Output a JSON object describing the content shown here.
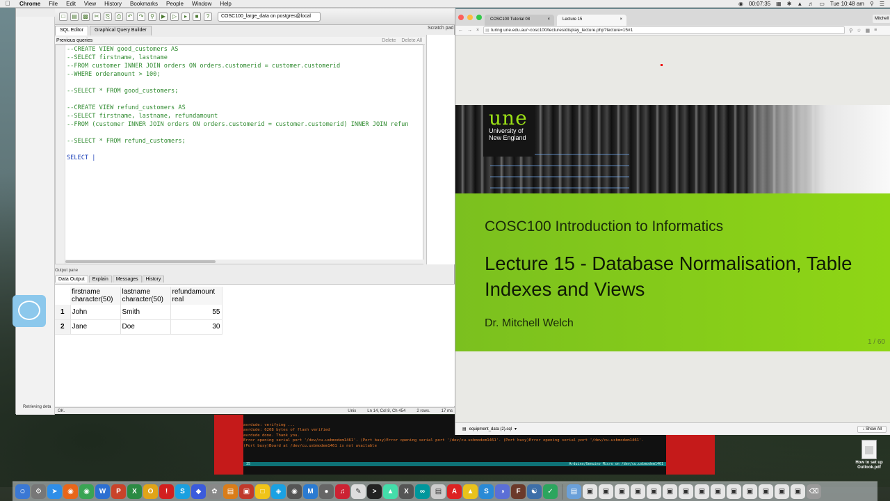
{
  "menubar": {
    "app_name": "Chrome",
    "items": [
      "File",
      "Edit",
      "View",
      "History",
      "Bookmarks",
      "People",
      "Window",
      "Help"
    ],
    "battery_time": "00:07:35",
    "clock": "Tue 10:48 am"
  },
  "pgadmin": {
    "connection": "COSC100_large_data on postgres@local",
    "tabs": [
      "SQL Editor",
      "Graphical Query Builder"
    ],
    "scratch_pad_label": "Scratch pad",
    "previous_queries_label": "Previous queries",
    "delete_label": "Delete",
    "delete_all_label": "Delete All",
    "code_lines": [
      {
        "text": "--CREATE VIEW good_customers AS",
        "type": "c"
      },
      {
        "text": "--SELECT firstname, lastname",
        "type": "c"
      },
      {
        "text": "--FROM customer INNER JOIN orders ON orders.customerid = customer.customerid",
        "type": "c"
      },
      {
        "text": "--WHERE orderamount > 100;",
        "type": "c"
      },
      {
        "text": "",
        "type": "c"
      },
      {
        "text": "--SELECT * FROM good_customers;",
        "type": "c"
      },
      {
        "text": "",
        "type": "c"
      },
      {
        "text": "--CREATE VIEW refund_customers AS",
        "type": "c"
      },
      {
        "text": "--SELECT firstname, lastname, refundamount",
        "type": "c"
      },
      {
        "text": "--FROM (customer INNER JOIN orders ON orders.customerid = customer.customerid) INNER JOIN refun",
        "type": "c"
      },
      {
        "text": "",
        "type": "c"
      },
      {
        "text": "--SELECT * FROM refund_customers;",
        "type": "c"
      },
      {
        "text": "",
        "type": "c"
      },
      {
        "text": "SELECT |",
        "type": "k"
      }
    ],
    "output_pane_label": "Output pane",
    "output_tabs": [
      "Data Output",
      "Explain",
      "Messages",
      "History"
    ],
    "columns": [
      {
        "name": "firstname",
        "type": "character(50)"
      },
      {
        "name": "lastname",
        "type": "character(50)"
      },
      {
        "name": "refundamount",
        "type": "real"
      }
    ],
    "rows": [
      {
        "n": "1",
        "firstname": "John",
        "lastname": "Smith",
        "refundamount": "55"
      },
      {
        "n": "2",
        "firstname": "Jane",
        "lastname": "Doe",
        "refundamount": "30"
      }
    ],
    "status": {
      "ok": "OK.",
      "encoding": "Unix",
      "position": "Ln 14, Col 8, Ch 454",
      "rows": "2 rows.",
      "time": "17 ms"
    },
    "left_status": "Retrieving deta"
  },
  "arduino": {
    "lines": [
      "avrdude: verifying ...",
      "avrdude: 6208 bytes of flash verified",
      "",
      "avrdude done.  Thank you.",
      "Error opening serial port '/dev/cu.usbmodem1461'. (Port busy)Error opening serial port '/dev/cu.usbmodem1461'. (Port busy)Error opening serial port '/dev/cu.usbmodem1461'.",
      "(Port busy)Board at /dev/cu.usbmodem1461 is not available"
    ],
    "line_number": "35",
    "board": "Arduino/Genuino Micro on /dev/cu.usbmodem1461"
  },
  "chrome": {
    "tabs": [
      {
        "label": "COSC100 Tutorial 08"
      },
      {
        "label": "Lecture 15"
      }
    ],
    "user": "Mitchell",
    "url": "turing.une.edu.au/~cosc100/lectures/display_lecture.php?lecture=15#1",
    "slide": {
      "logo_big": "une",
      "logo_line1": "University of",
      "logo_line2": "New England",
      "course": "COSC100 Introduction to Informatics",
      "lecture": "Lecture 15 - Database Normalisation, Table Indexes and Views",
      "author": "Dr. Mitchell Welch",
      "page": "1 / 60"
    },
    "download": "equipment_data (2).sql",
    "show_all": "Show All"
  },
  "desktop": {
    "file_label_1": "How to set up",
    "file_label_2": "Outlook.pdf"
  },
  "colors": {
    "slide_green": "#8fd615",
    "une_green": "#9be016",
    "comment_green": "#2f8a2f",
    "keyword_blue": "#1a3fb8"
  }
}
